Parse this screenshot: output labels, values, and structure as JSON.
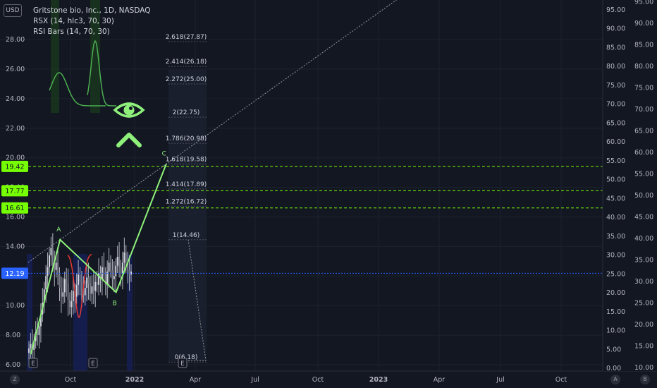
{
  "legend": {
    "currency": "USD",
    "title": "Gritstone bio, Inc., 1D, NASDAQ",
    "rsx": "RSX (14, hlc3, 70, 30)",
    "rsi_bars": "RSI Bars (14, 70, 30)"
  },
  "chart_data": {
    "type": "line",
    "symbol": "Gritstone bio, Inc.",
    "timeframe": "1D",
    "exchange": "NASDAQ",
    "x_ticks": [
      "Oct",
      "2022",
      "Apr",
      "Jul",
      "Oct",
      "2023",
      "Apr",
      "Jul",
      "Oct"
    ],
    "price_axis": {
      "ticks": [
        6,
        8,
        10,
        12,
        14,
        16,
        18,
        20,
        22,
        24,
        26,
        28
      ],
      "range": [
        5.9,
        29.6
      ]
    },
    "osc_axis_1": {
      "ticks": [
        0,
        5,
        10,
        15,
        20,
        25,
        30,
        35,
        40,
        45,
        50,
        55,
        60,
        65,
        70,
        75,
        80,
        85,
        90,
        95
      ]
    },
    "osc_axis_2": {
      "ticks": [
        10,
        15,
        20,
        25,
        30,
        35,
        40,
        45,
        50,
        55,
        60,
        65,
        70,
        75,
        80,
        85,
        90,
        95
      ]
    },
    "price_labels": [
      {
        "value": 19.42,
        "text": "19.42",
        "color": "#76ff03"
      },
      {
        "value": 17.77,
        "text": "17.77",
        "color": "#76ff03"
      },
      {
        "value": 16.61,
        "text": "16.61",
        "color": "#76ff03"
      },
      {
        "value": 12.19,
        "text": "12.19",
        "color": "#2962ff"
      }
    ],
    "wave_points": [
      {
        "label": "",
        "date": "2021-08-01",
        "price": 6.7
      },
      {
        "label": "A",
        "date": "2021-09-15",
        "price": 14.46
      },
      {
        "label": "B",
        "date": "2021-12-10",
        "price": 10.9
      },
      {
        "label": "C",
        "date": "2022-02-25",
        "price": 19.58
      }
    ],
    "fib_levels": [
      {
        "label": "0(6.18)",
        "ratio": 0,
        "price": 6.18
      },
      {
        "label": "1(14.46)",
        "ratio": 1,
        "price": 14.46
      },
      {
        "label": "1.272(16.72)",
        "ratio": 1.272,
        "price": 16.72
      },
      {
        "label": "1.414(17.89)",
        "ratio": 1.414,
        "price": 17.89
      },
      {
        "label": "1.618(19.58)",
        "ratio": 1.618,
        "price": 19.58
      },
      {
        "label": "1.786(20.98)",
        "ratio": 1.786,
        "price": 20.98
      },
      {
        "label": "2(22.75)",
        "ratio": 2,
        "price": 22.75
      },
      {
        "label": "2.272(25.00)",
        "ratio": 2.272,
        "price": 25.0
      },
      {
        "label": "2.414(26.18)",
        "ratio": 2.414,
        "price": 26.18
      },
      {
        "label": "2.618(27.87)",
        "ratio": 2.618,
        "price": 27.87
      }
    ],
    "candles_close": [
      7.1,
      7.4,
      7.0,
      7.6,
      8.2,
      8.0,
      8.6,
      9.4,
      10.2,
      11.1,
      12.0,
      12.6,
      13.4,
      13.9,
      13.2,
      12.4,
      12.9,
      12.1,
      11.2,
      10.6,
      10.9,
      11.8,
      11.5,
      10.4,
      9.9,
      10.3,
      11.0,
      10.6,
      11.4,
      12.1,
      11.6,
      11.0,
      10.7,
      11.2,
      11.9,
      11.5,
      10.8,
      11.3,
      11.0,
      11.6,
      11.4,
      12.2,
      11.8,
      12.6,
      12.1,
      11.4,
      12.3,
      12.9,
      12.4,
      11.8,
      12.0,
      12.7,
      13.3,
      12.6,
      12.2,
      12.9,
      13.6,
      12.9,
      12.4,
      12.1,
      12.3
    ],
    "legend_position": "top-left",
    "grid": true
  },
  "labels": {
    "wave_a": "A",
    "wave_b": "B",
    "wave_c": "C",
    "event_e": "E"
  },
  "icons": {
    "eye": "eye-icon",
    "chevron": "chevron-up-icon"
  },
  "colors": {
    "background": "#131722",
    "wave": "#8ef07a",
    "level_line": "#76ff03",
    "last_price": "#2962ff",
    "fib_text": "#d1d4dc",
    "axis_text": "#b2b5be",
    "rsx_line": "#4caf50",
    "rsx_red": "#e53935"
  },
  "corner_buttons": {
    "left": "Z",
    "a": "A",
    "b": "B"
  }
}
